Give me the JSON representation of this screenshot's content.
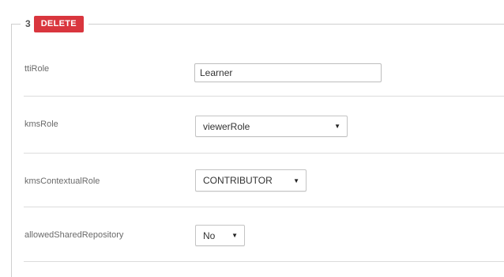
{
  "section": {
    "number": "3",
    "delete_label": "DELETE"
  },
  "fields": {
    "ttiRole": {
      "label": "ttiRole",
      "value": "Learner"
    },
    "kmsRole": {
      "label": "kmsRole",
      "value": "viewerRole"
    },
    "kmsContextualRole": {
      "label": "kmsContextualRole",
      "value": "CONTRIBUTOR"
    },
    "allowedSharedRepository": {
      "label": "allowedSharedRepository",
      "value": "No"
    }
  },
  "icons": {
    "dropdown_caret": "▼"
  }
}
